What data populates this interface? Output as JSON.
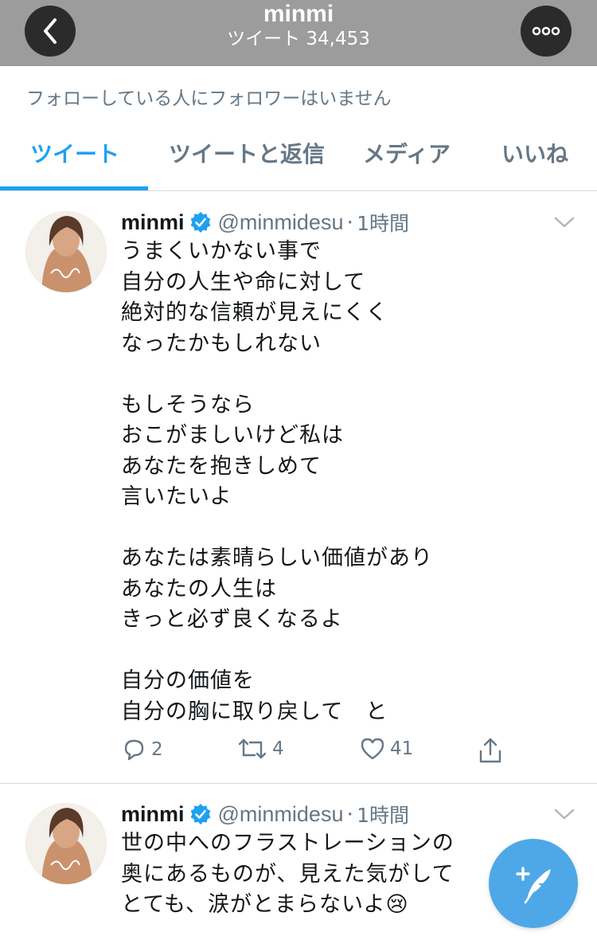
{
  "header": {
    "title": "minmi",
    "subtitle": "ツイート 34,453",
    "back_icon": "chevron-left-icon",
    "more_icon": "more-horizontal-icon"
  },
  "profile_note": "フォローしている人にフォロワーはいません",
  "tabs": [
    {
      "label": "ツイート",
      "active": true
    },
    {
      "label": "ツイートと返信",
      "active": false
    },
    {
      "label": "メディア",
      "active": false
    },
    {
      "label": "いいね",
      "active": false
    }
  ],
  "tweets": [
    {
      "name": "minmi",
      "handle": "@minmidesu",
      "separator": "·",
      "time": "1時間",
      "text": "うまくいかない事で\n自分の人生や命に対して\n絶対的な信頼が見えにくく\nなったかもしれない\n\nもしそうなら\nおこがましいけど私は\nあなたを抱きしめて\n言いたいよ\n\nあなたは素晴らしい価値があり\nあなたの人生は\nきっと必ず良くなるよ\n\n自分の価値を\n自分の胸に取り戻して　と",
      "replies": "2",
      "retweets": "4",
      "likes": "41"
    },
    {
      "name": "minmi",
      "handle": "@minmidesu",
      "separator": "·",
      "time": "1時間",
      "text": "世の中へのフラストレーションの\n奥にあるものが、見えた気がして\nとても、涙がとまらないよ😢"
    }
  ],
  "colors": {
    "accent": "#1da1f2",
    "header_bg": "#9c9c9c",
    "muted": "#657786",
    "fab": "#4ea8e8"
  },
  "fab_icon": "compose-tweet-icon"
}
